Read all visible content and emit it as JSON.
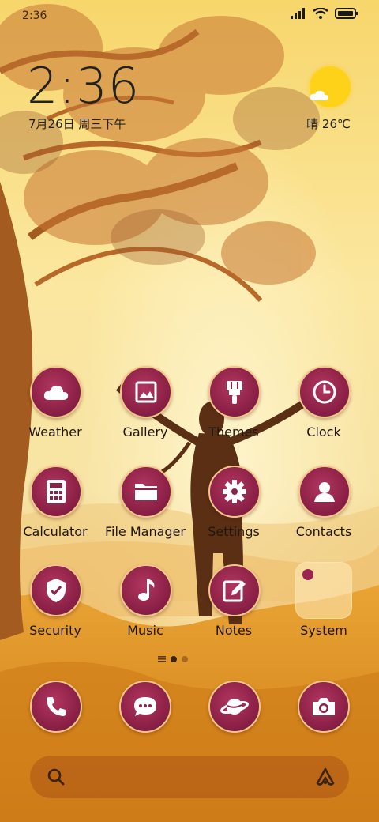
{
  "status_bar": {
    "time": "2:36"
  },
  "clock": {
    "time": "2:36",
    "date": "7月26日 周三下午"
  },
  "weather": {
    "text": "晴 26℃",
    "icon": "sun-cloud-icon"
  },
  "apps": [
    {
      "label": "Weather",
      "icon": "cloud-icon"
    },
    {
      "label": "Gallery",
      "icon": "image-icon"
    },
    {
      "label": "Themes",
      "icon": "paintbrush-icon"
    },
    {
      "label": "Clock",
      "icon": "clock-icon"
    },
    {
      "label": "Calculator",
      "icon": "calculator-icon"
    },
    {
      "label": "File Manager",
      "icon": "folder-icon"
    },
    {
      "label": "Settings",
      "icon": "gear-icon"
    },
    {
      "label": "Contacts",
      "icon": "person-icon"
    },
    {
      "label": "Security",
      "icon": "shield-check-icon"
    },
    {
      "label": "Music",
      "icon": "music-note-icon"
    },
    {
      "label": "Notes",
      "icon": "edit-note-icon"
    },
    {
      "label": "System",
      "icon": "folder-icon"
    }
  ],
  "dock": [
    {
      "icon": "phone-icon"
    },
    {
      "icon": "message-icon"
    },
    {
      "icon": "browser-planet-icon"
    },
    {
      "icon": "camera-icon"
    }
  ],
  "colors": {
    "icon_fill": "#8d2147",
    "icon_border": "#f2c58a",
    "sky": "#fbe7a0",
    "ground": "#d98a22"
  }
}
